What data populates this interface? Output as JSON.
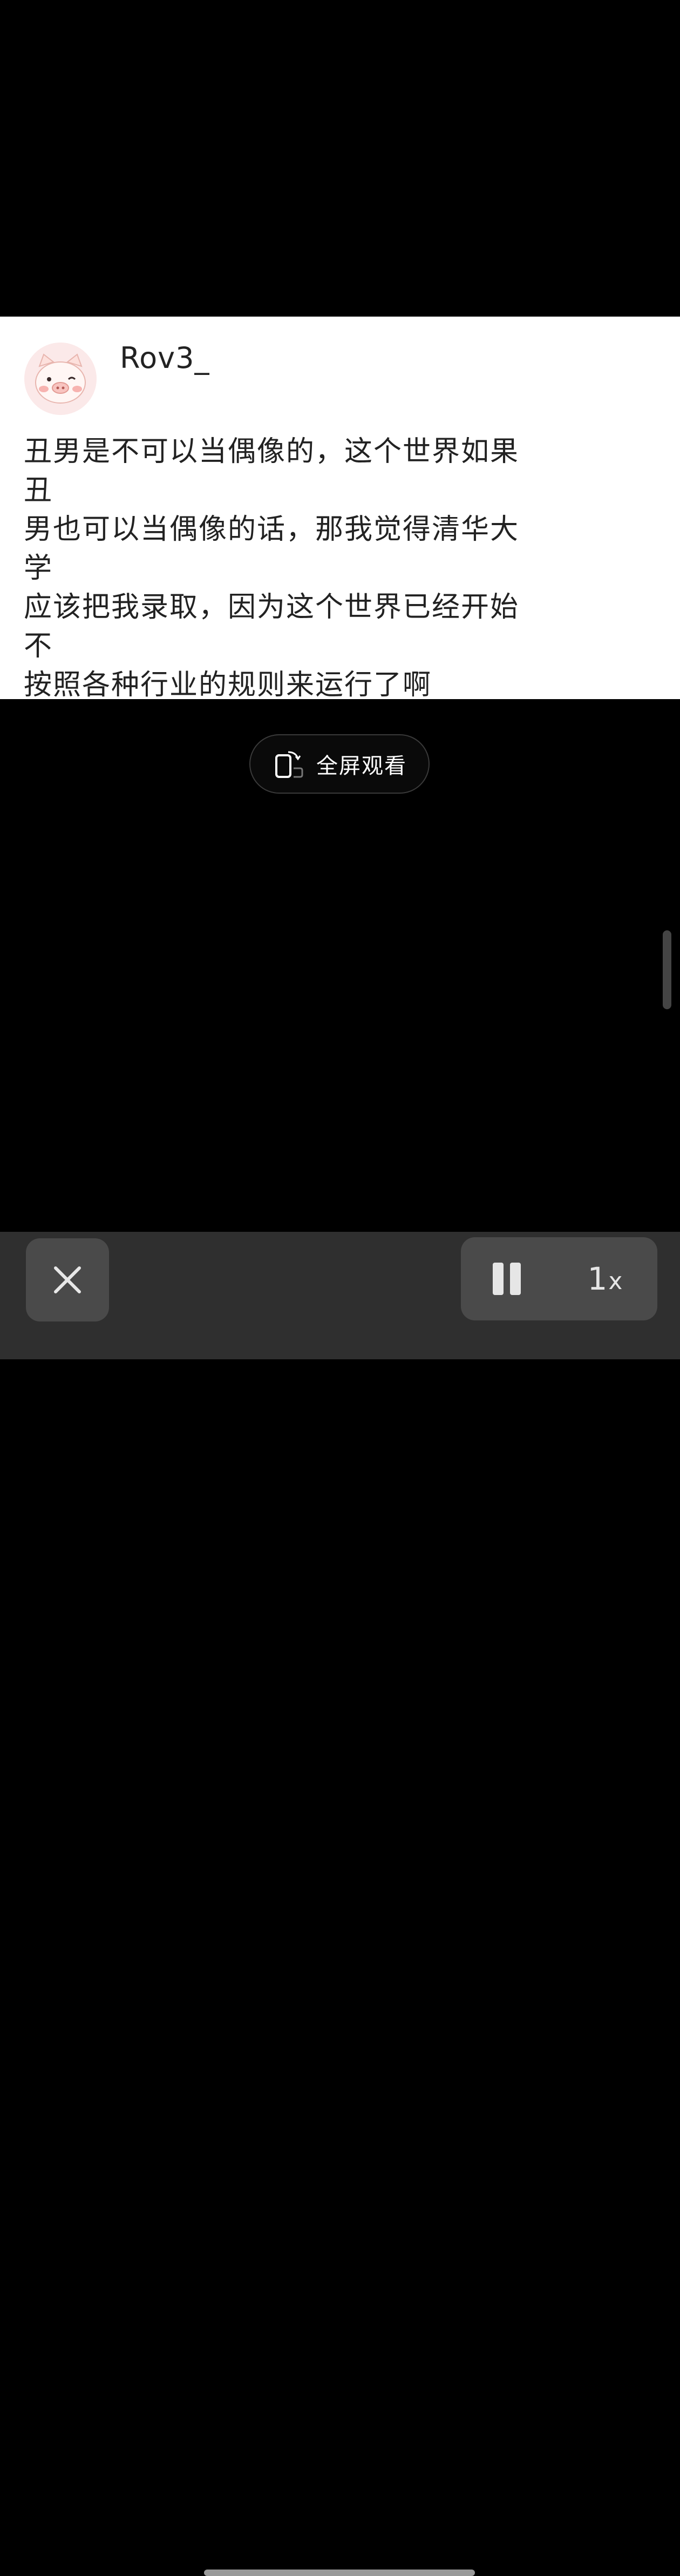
{
  "comment": {
    "username": "Rov3_",
    "text": "丑男是不可以当偶像的，这个世界如果丑\n男也可以当偶像的话，那我觉得清华大学\n应该把我录取，因为这个世界已经开始不\n按照各种行业的规则来运行了啊"
  },
  "video": {
    "fullscreen_label": "全屏观看"
  },
  "controls": {
    "speed_value": "1",
    "speed_suffix": "x"
  },
  "colors": {
    "background": "#000000",
    "card": "#ffffff",
    "control_bar": "#2f2f2f",
    "control_button": "#4a4a4a"
  }
}
